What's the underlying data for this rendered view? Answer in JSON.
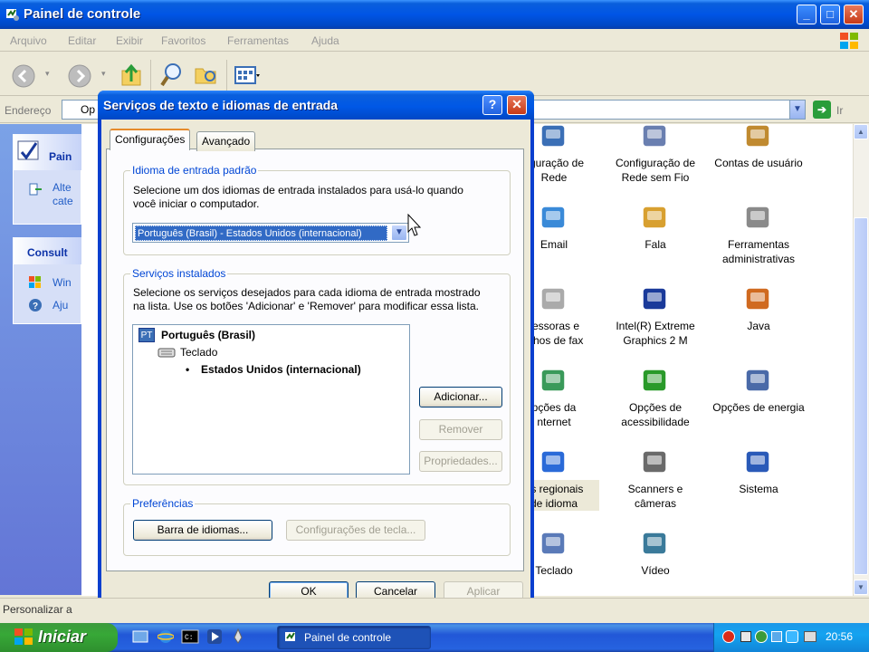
{
  "window": {
    "title": "Painel de controle",
    "icon": "control-panel-icon",
    "controls": {
      "minimize": "_",
      "maximize": "□",
      "close": "✕"
    }
  },
  "menubar": [
    "Arquivo",
    "Editar",
    "Exibir",
    "Favoritos",
    "Ferramentas",
    "Ajuda"
  ],
  "address": {
    "label": "Endereço",
    "value": "Op",
    "go_label": "Ir"
  },
  "left_pane": {
    "task_title": "Pain",
    "task_links": [
      "Alte",
      "cate"
    ],
    "see_also_title": "Consult",
    "see_also_links": [
      "Win",
      "Aju"
    ]
  },
  "items": [
    {
      "label": "figuração de\nRede",
      "icon": "network-icon"
    },
    {
      "label": "Configuração de\nRede sem Fio",
      "icon": "wireless-network-icon"
    },
    {
      "label": "Contas de usuário",
      "icon": "user-accounts-icon"
    },
    {
      "label": "Email",
      "icon": "email-icon"
    },
    {
      "label": "Fala",
      "icon": "speech-icon"
    },
    {
      "label": "Ferramentas\nadministrativas",
      "icon": "admin-tools-icon"
    },
    {
      "label": "ressoras e\nelhos de fax",
      "icon": "printer-icon"
    },
    {
      "label": "Intel(R) Extreme\nGraphics 2 M",
      "icon": "intel-graphics-icon"
    },
    {
      "label": "Java",
      "icon": "java-icon"
    },
    {
      "label": "pções da\nnternet",
      "icon": "internet-options-icon"
    },
    {
      "label": "Opções de\nacessibilidade",
      "icon": "accessibility-icon"
    },
    {
      "label": "Opções de energia",
      "icon": "power-options-icon"
    },
    {
      "label": "es regionais\nde idioma",
      "icon": "regional-language-icon"
    },
    {
      "label": "Scanners e\ncâmeras",
      "icon": "scanner-camera-icon"
    },
    {
      "label": "Sistema",
      "icon": "system-icon"
    },
    {
      "label": "Teclado",
      "icon": "keyboard-icon"
    },
    {
      "label": "Vídeo",
      "icon": "video-icon"
    }
  ],
  "status_text": "Personalizar a",
  "dialog": {
    "title": "Serviços de texto e idiomas de entrada",
    "help": "?",
    "close": "✕",
    "tabs": [
      "Configurações",
      "Avançado"
    ],
    "default_group": {
      "title": "Idioma de entrada padrão",
      "description_1": "Selecione um dos idiomas de entrada instalados para usá-lo quando",
      "description_2": "você iniciar o computador.",
      "selected": "Português (Brasil) - Estados Unidos (internacional)"
    },
    "installed_group": {
      "title": "Serviços instalados",
      "description_1": "Selecione os serviços desejados para cada idioma de entrada mostrado",
      "description_2": "na lista. Use os botões 'Adicionar' e 'Remover' para modificar essa lista.",
      "tree": {
        "badge": "PT",
        "language": "Português (Brasil)",
        "category": "Teclado",
        "layout": "Estados Unidos (internacional)"
      },
      "buttons": {
        "add": "Adicionar...",
        "remove": "Remover",
        "properties": "Propriedades..."
      }
    },
    "prefs_group": {
      "title": "Preferências",
      "language_bar": "Barra de idiomas...",
      "key_settings": "Configurações de tecla..."
    },
    "buttons": {
      "ok": "OK",
      "cancel": "Cancelar",
      "apply": "Aplicar"
    }
  },
  "taskbar": {
    "start": "Iniciar",
    "task": "Painel de controle",
    "clock": "20:56"
  },
  "colors": {
    "xp_blue": "#0058e6",
    "start_green": "#37a837",
    "link_blue": "#215dc6",
    "group_title": "#0046d5"
  }
}
